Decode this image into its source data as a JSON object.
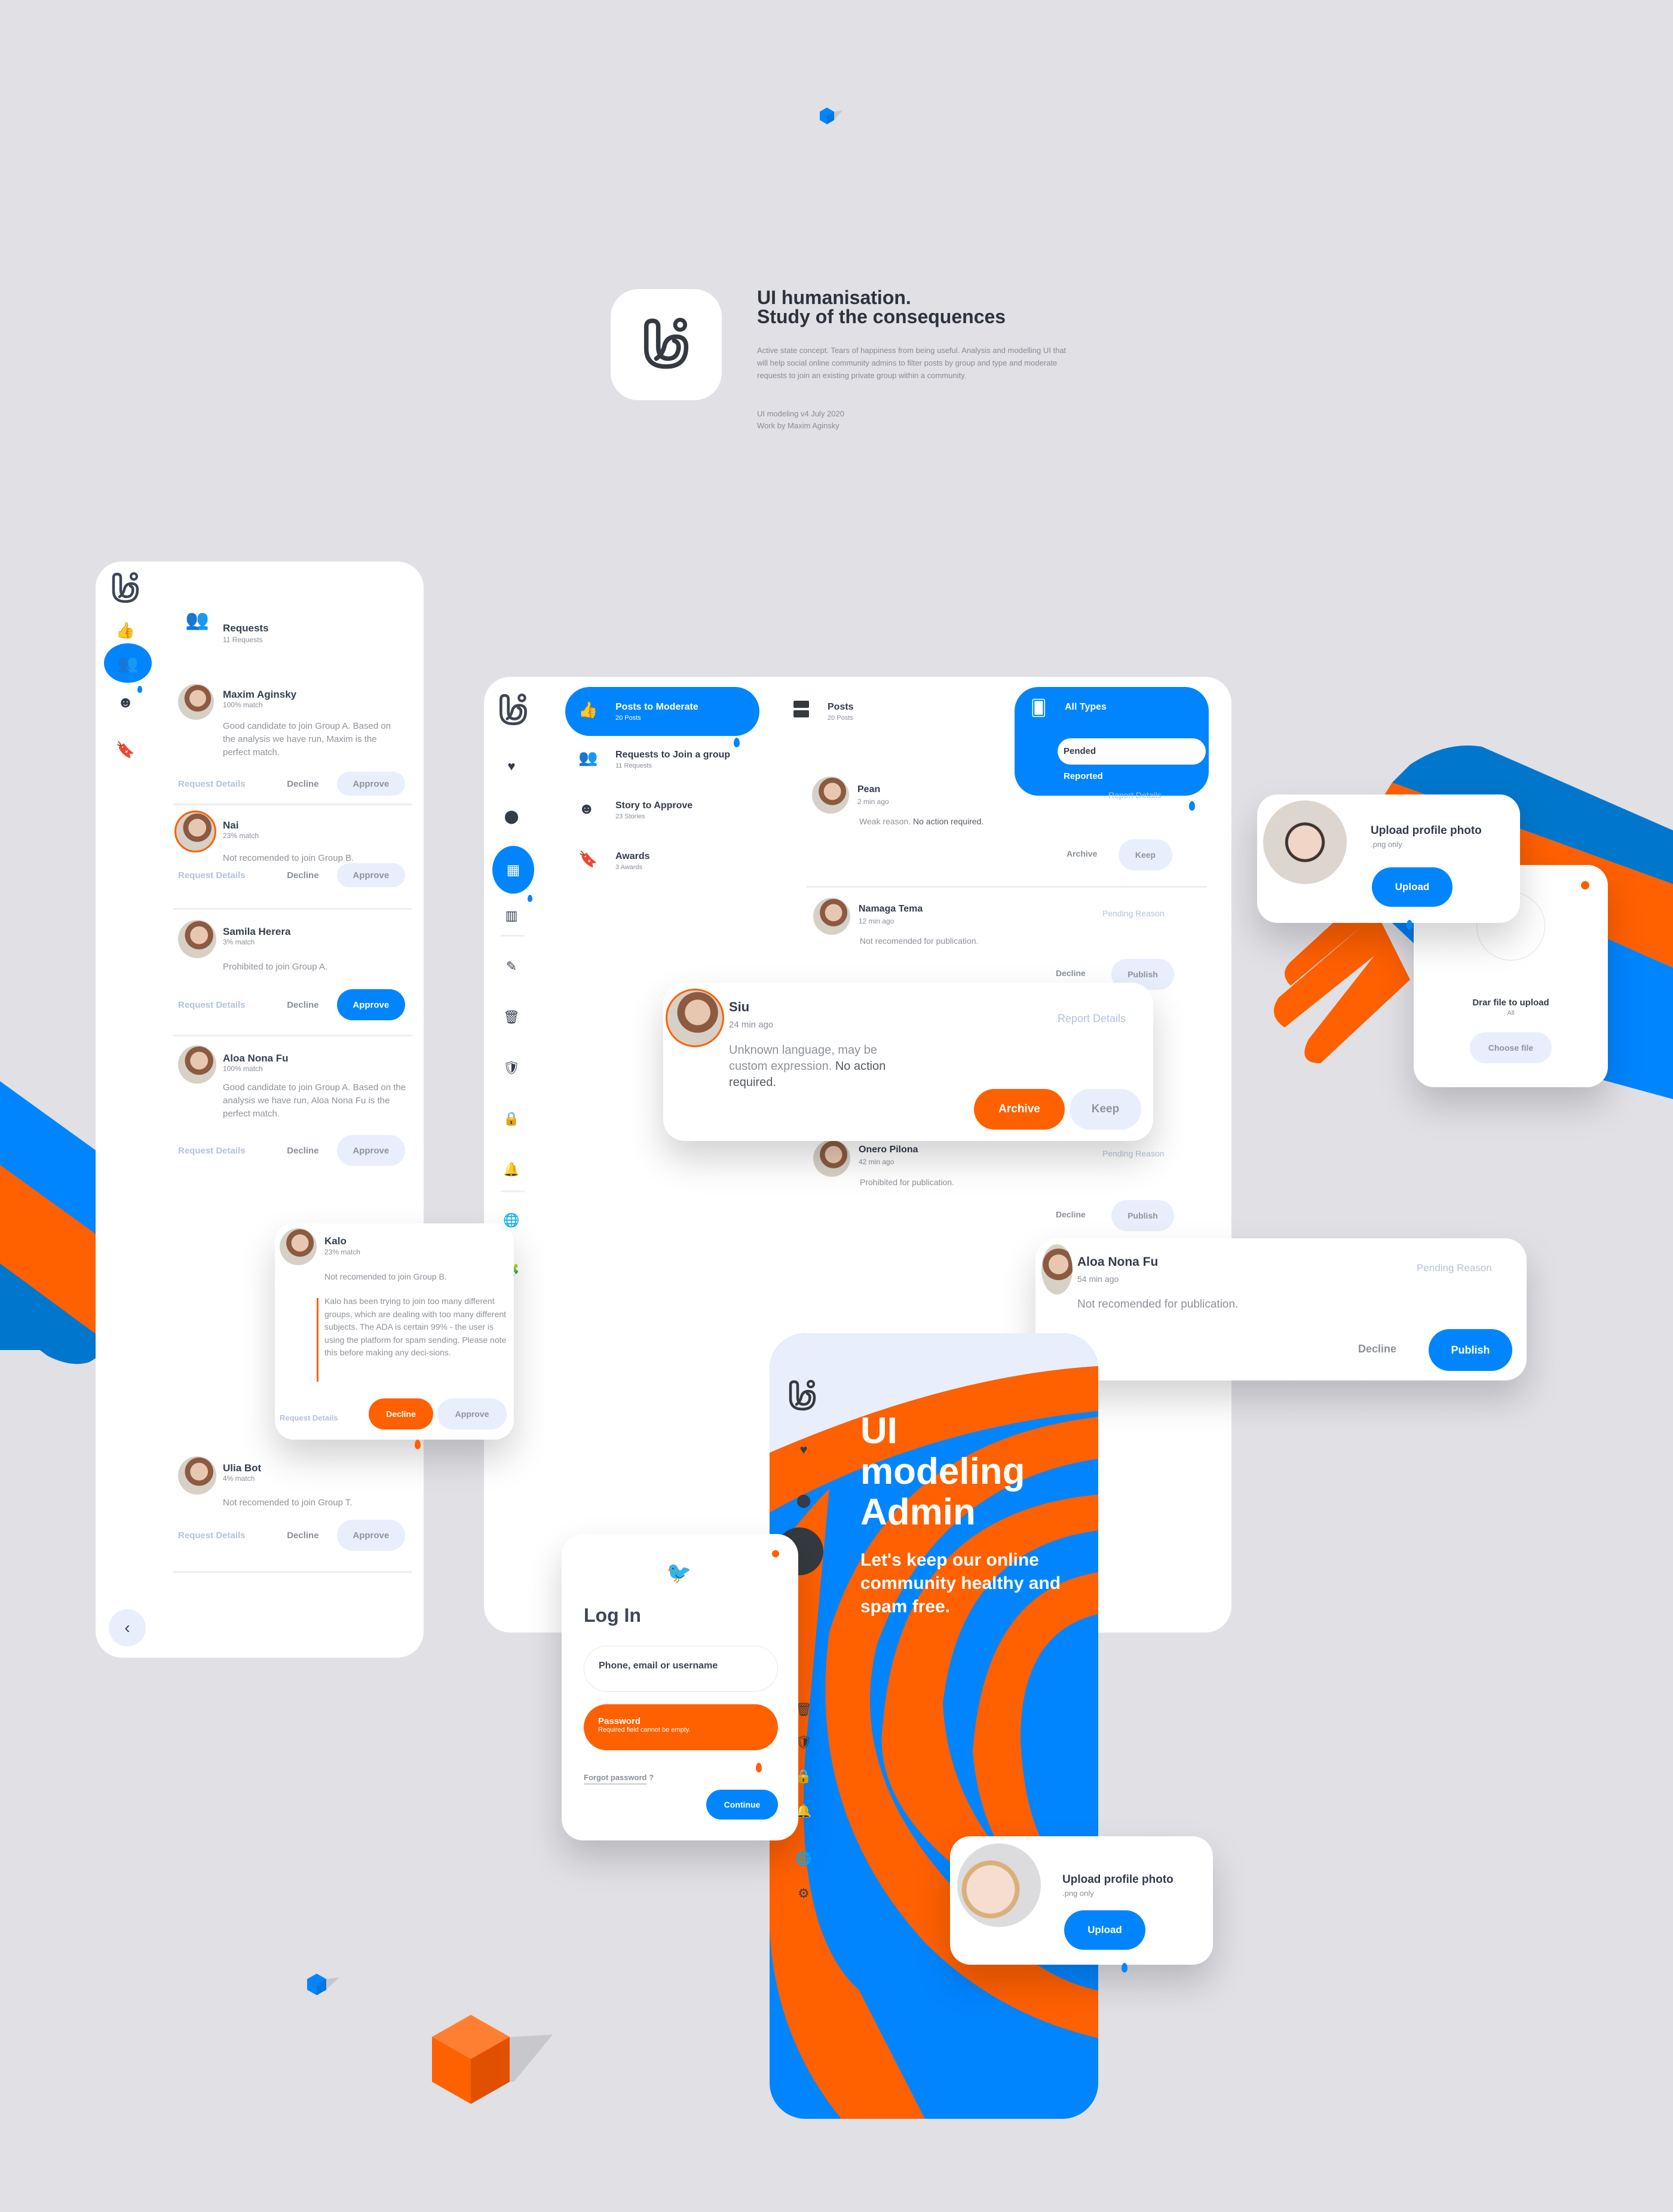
{
  "colors": {
    "blue": "#0085ff",
    "orange": "#ff6000",
    "bg": "#e0e0e5",
    "soft": "#e8eefb",
    "text": "#343c4a"
  },
  "header": {
    "logo_icon": "ui-logo-icon",
    "title_line1": "UI humanisation.",
    "title_line2": "Study of the consequences",
    "description": "Active state concept. Tears of happiness from being useful. Analysis and modelling UI that will help social online community admins to filter posts by group and type and moderate requests to join an existing private group within a community.",
    "version": "UI modeling v4 July 2020",
    "author": "Work by Maxim Aginsky"
  },
  "requests_panel": {
    "nav_icons": [
      "ui-logo-icon",
      "thumbs-up-down-icon",
      "group-icon",
      "face-icon",
      "bookmark-icon"
    ],
    "header_title": "Requests",
    "header_count": "11 Requests",
    "action_details": "Request Details",
    "action_decline": "Decline",
    "action_approve": "Approve",
    "items": [
      {
        "name": "Maxim Aginsky",
        "match": "100% match",
        "text": "Good candidate to join Group A. Based on the analysis we have run, Maxim is the perfect match."
      },
      {
        "name": "Nai",
        "match": "23% match",
        "text": "Not recomended to join Group B."
      },
      {
        "name": "Samila Herera",
        "match": "3% match",
        "text": "Prohibited to join Group A."
      },
      {
        "name": "Aloa Nona Fu",
        "match": "100% match",
        "text": "Good candidate to join Group A. Based on the analysis we have run, Aloa Nona Fu is the perfect match."
      },
      {
        "name": "Ulia Bot",
        "match": "4% match",
        "text": "Not recomended to join Group T."
      }
    ],
    "back_icon": "chevron-left-icon"
  },
  "kalo_card": {
    "name": "Kalo",
    "match": "23% match",
    "text": "Not recomended to join Group B.",
    "note": "Kalo has been trying to join too many different groups, which are dealing with too many different subjects. The ADA is certain 99% - the user is using the platform for spam sending. Please note this before making any deci-sions.",
    "details": "Request Details",
    "decline": "Decline",
    "approve": "Approve"
  },
  "moderation_panel": {
    "menu": [
      {
        "title": "Posts to Moderate",
        "count": "20 Posts",
        "icon": "thumbs-up-down-icon"
      },
      {
        "title": "Requests to Join a group",
        "count": "11 Requests",
        "icon": "group-icon"
      },
      {
        "title": "Story to Approve",
        "count": "23 Stories",
        "icon": "face-icon"
      },
      {
        "title": "Awards",
        "count": "3 Awards",
        "icon": "bookmark-icon"
      }
    ],
    "posts_title": "Posts",
    "posts_count": "20 Posts",
    "filter": {
      "label": "All Types",
      "options": [
        "Pended",
        "Reported"
      ],
      "selected": "Pended"
    },
    "posts": [
      {
        "name": "Pean",
        "time": "2 min ago",
        "text_muted": "Weak reason.",
        "text_strong": "No action required.",
        "tag": "Report Details",
        "secondary": "Archive",
        "primary": "Keep"
      },
      {
        "name": "Namaga Tema",
        "time": "12 min ago",
        "text_muted": "Not recomended for publication.",
        "text_strong": "",
        "tag": "Pending Reason",
        "secondary": "Decline",
        "primary": "Publish"
      },
      {
        "name": "Onero Pilona",
        "time": "42 min ago",
        "text_muted": "Prohibited for publication.",
        "text_strong": "",
        "tag": "Pending Reason",
        "secondary": "Decline",
        "primary": "Publish"
      }
    ]
  },
  "siu_card": {
    "name": "Siu",
    "time": "24 min ago",
    "text_muted": "Unknown language, may be custom expression.",
    "text_strong": "No action required.",
    "tag": "Report Details",
    "archive": "Archive",
    "keep": "Keep"
  },
  "aloa_card": {
    "name": "Aloa Nona Fu",
    "time": "54 min ago",
    "text": "Not recomended for publication.",
    "tag": "Pending Reason",
    "decline": "Decline",
    "publish": "Publish"
  },
  "upload_card_1": {
    "title": "Upload profile photo",
    "subtitle": ".png only",
    "button": "Upload"
  },
  "drop_card": {
    "title": "Drar file to upload",
    "subtitle": "All",
    "button": "Choose file"
  },
  "login_card": {
    "title": "Log In",
    "username_placeholder": "Phone, email or username",
    "password_label": "Password",
    "password_error": "Required field cannot be empty.",
    "forgot": "Forgot password",
    "forgot_q": "?",
    "continue": "Continue"
  },
  "promo_phone": {
    "headline_1": "UI",
    "headline_2": "modeling",
    "headline_3": "Admin",
    "tagline": "Let's keep our online community healthy and spam free."
  },
  "upload_card_2": {
    "title": "Upload profile photo",
    "subtitle": ".png only",
    "button": "Upload"
  }
}
